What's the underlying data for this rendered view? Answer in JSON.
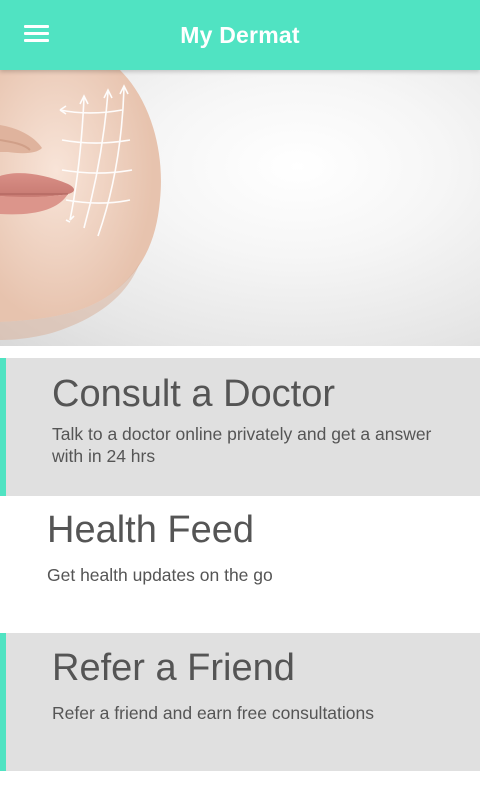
{
  "app_bar": {
    "title": "My Dermat",
    "background_color": "#50e3c2",
    "menu_icon": "hamburger-menu-icon"
  },
  "hero": {
    "image": "woman-face-skincare-arrows"
  },
  "cards": [
    {
      "title": "Consult a Doctor",
      "subtitle": "Talk to a doctor online privately and get a answer with in 24 hrs",
      "background": "#e0e0e0",
      "accent_color": "#50e3c2"
    },
    {
      "title": "Health Feed",
      "subtitle": "Get health updates on the go",
      "background": "#ffffff"
    },
    {
      "title": "Refer a Friend",
      "subtitle": "Refer a friend and earn free consultations",
      "background": "#e0e0e0",
      "accent_color": "#50e3c2"
    }
  ]
}
